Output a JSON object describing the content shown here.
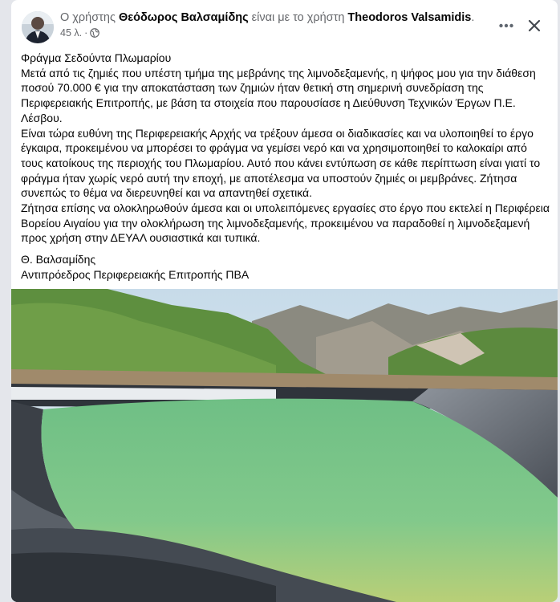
{
  "post": {
    "author_prefix": "Ο χρήστης ",
    "author_name": "Θεόδωρος Βαλσαμίδης",
    "author_mid": " είναι με το χρήστη ",
    "tagged_name": "Theodoros Valsamidis",
    "author_suffix": ".",
    "time": "45 λ.",
    "separator": "·",
    "privacy_icon": "globe-icon",
    "more_icon": "more-horizontal-icon",
    "close_icon": "close-icon",
    "text": {
      "title": "Φράγμα Σεδούντα Πλωμαρίου",
      "p1": "Μετά από τις ζημιές που υπέστη τμήμα της μεβράνης της λιμνοδεξαμενής, η ψήφος μου για την διάθεση ποσού 70.000 €  για την αποκατάσταση των ζημιών ήταν θετική στη σημερινή συνεδρίαση της Περιφερειακής Επιτροπής, με βάση τα στοιχεία που παρουσίασε η Διεύθυνση Τεχνικών Έργων Π.Ε. Λέσβου.",
      "p2": "Είναι τώρα ευθύνη της Περιφερειακής Αρχής να τρέξουν άμεσα οι διαδικασίες και να υλοποιηθεί το έργο έγκαιρα, προκειμένου να μπορέσει το φράγμα να γεμίσει νερό και να χρησιμοποιηθεί το καλοκαίρι από τους κατοίκους της περιοχής του Πλωμαρίου. Αυτό που κάνει εντύπωση σε κάθε περίπτωση είναι γιατί το φράγμα ήταν χωρίς νερό αυτή την εποχή, με αποτέλεσμα να υποστούν ζημιές οι μεμβράνες. Ζήτησα συνεπώς το θέμα να διερευνηθεί και να απαντηθεί σχετικά.",
      "p3": "Ζήτησα επίσης να ολοκληρωθούν άμεσα και οι υπολειπόμενες εργασίες στο έργο που εκτελεί η Περιφέρεια Βορείου Αιγαίου για την ολοκλήρωση της λιμνοδεξαμενής, προκειμένου να παραδοθεί η λιμνοδεξαμενή προς χρήση στην ΔΕΥΑΛ ουσιαστικά και τυπικά.",
      "sig_name": "Θ. Βαλσαμίδης",
      "sig_title": "Αντιπρόεδρος Περιφερειακής Επιτροπής ΠΒΑ"
    }
  },
  "colors": {
    "page_bg": "#e4e6eb",
    "card_bg": "#ffffff",
    "text_primary": "#050505",
    "text_secondary": "#65676b",
    "reservoir_water": "#7cc58a"
  }
}
